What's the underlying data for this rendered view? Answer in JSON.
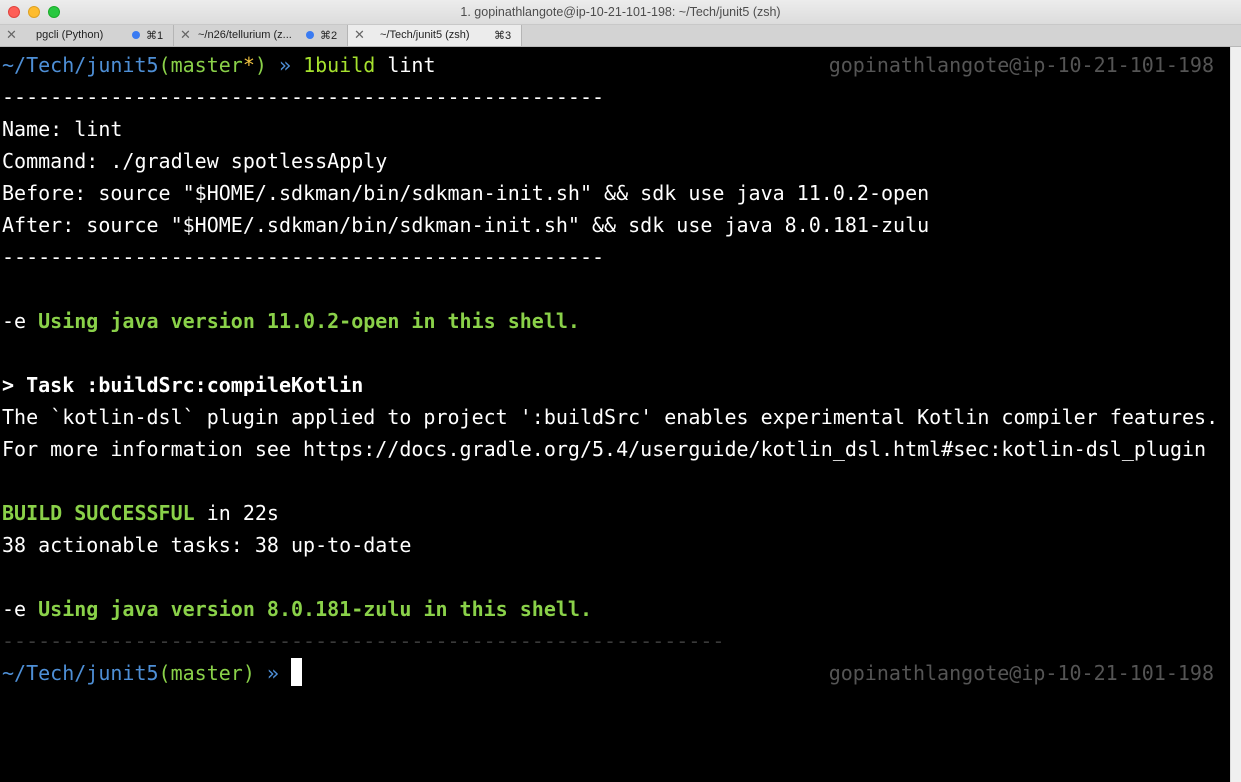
{
  "window": {
    "title": "1. gopinathlangote@ip-10-21-101-198: ~/Tech/junit5 (zsh)"
  },
  "tabs": [
    {
      "label": "pgcli (Python)",
      "shortcut": "⌘1"
    },
    {
      "label": "~/n26/tellurium (z...",
      "shortcut": "⌘2"
    },
    {
      "label": "~/Tech/junit5 (zsh)",
      "shortcut": "⌘3"
    }
  ],
  "terminal": {
    "prompt1": {
      "path": "~/Tech/junit5",
      "branch_open": "(",
      "branch": "master",
      "dirty": "*",
      "branch_close": ")",
      "arrow": " » ",
      "command": "1build",
      "arg": " lint",
      "right": "gopinathlangote@ip-10-21-101-198"
    },
    "sep1": "--------------------------------------------------",
    "name_line": "Name: lint",
    "command_line": "Command: ./gradlew spotlessApply",
    "before_line": "Before: source \"$HOME/.sdkman/bin/sdkman-init.sh\" && sdk use java 11.0.2-open",
    "after_line": "After: source \"$HOME/.sdkman/bin/sdkman-init.sh\" && sdk use java 8.0.181-zulu",
    "sep2": "--------------------------------------------------",
    "using1_prefix": "-e ",
    "using1_text": "Using java version 11.0.2-open in this shell.",
    "task_line": "> Task :buildSrc:compileKotlin",
    "kotlin_line1": "The `kotlin-dsl` plugin applied to project ':buildSrc' enables experimental Kotlin compiler features.",
    "kotlin_line2": "For more information see https://docs.gradle.org/5.4/userguide/kotlin_dsl.html#sec:kotlin-dsl_plugin",
    "build_status": "BUILD SUCCESSFUL",
    "build_time": " in 22s",
    "tasks_line": "38 actionable tasks: 38 up-to-date",
    "using2_prefix": "-e ",
    "using2_text": "Using java version 8.0.181-zulu in this shell.",
    "sep3": "------------------------------------------------------------",
    "prompt2": {
      "path": "~/Tech/junit5",
      "branch_open": "(",
      "branch": "master",
      "branch_close": ")",
      "arrow": " » ",
      "right": "gopinathlangote@ip-10-21-101-198"
    }
  },
  "colors": {
    "path": "#4e8fd6",
    "branch": "#8ad149",
    "dirty": "#f4c542",
    "success": "#8ad149",
    "dim": "#555555"
  }
}
